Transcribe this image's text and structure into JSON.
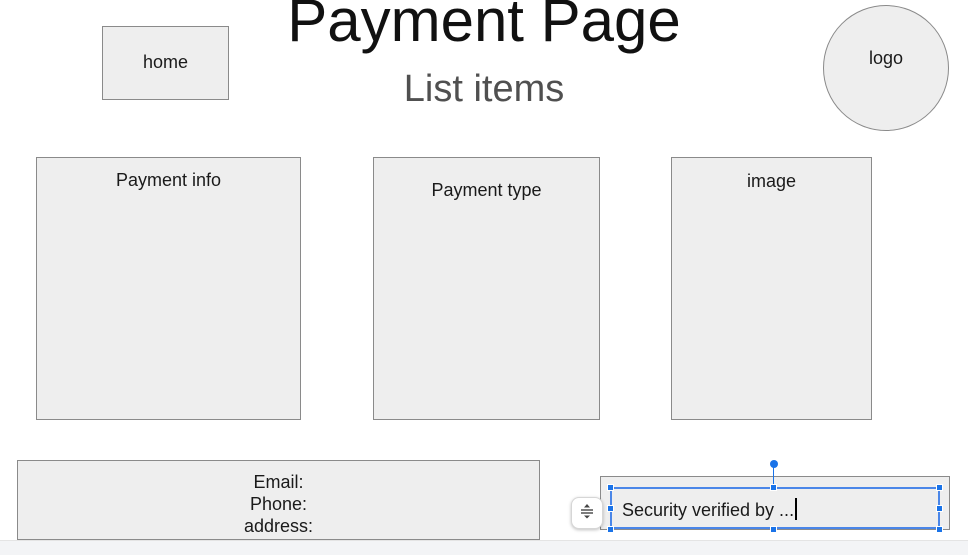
{
  "header": {
    "title": "Payment Page",
    "subtitle": "List items"
  },
  "home_button": {
    "label": "home"
  },
  "logo": {
    "label": "logo"
  },
  "panels": {
    "payment_info": "Payment info",
    "payment_type": "Payment type",
    "image": "image"
  },
  "contact": {
    "email": "Email:",
    "phone": "Phone:",
    "address": "address:"
  },
  "security": {
    "text": "Security verified by ..."
  },
  "icons": {
    "align": "vertical-align-icon"
  },
  "colors": {
    "box_fill": "#eeeeee",
    "box_border": "#8a8a8a",
    "selection": "#1a73e8"
  }
}
